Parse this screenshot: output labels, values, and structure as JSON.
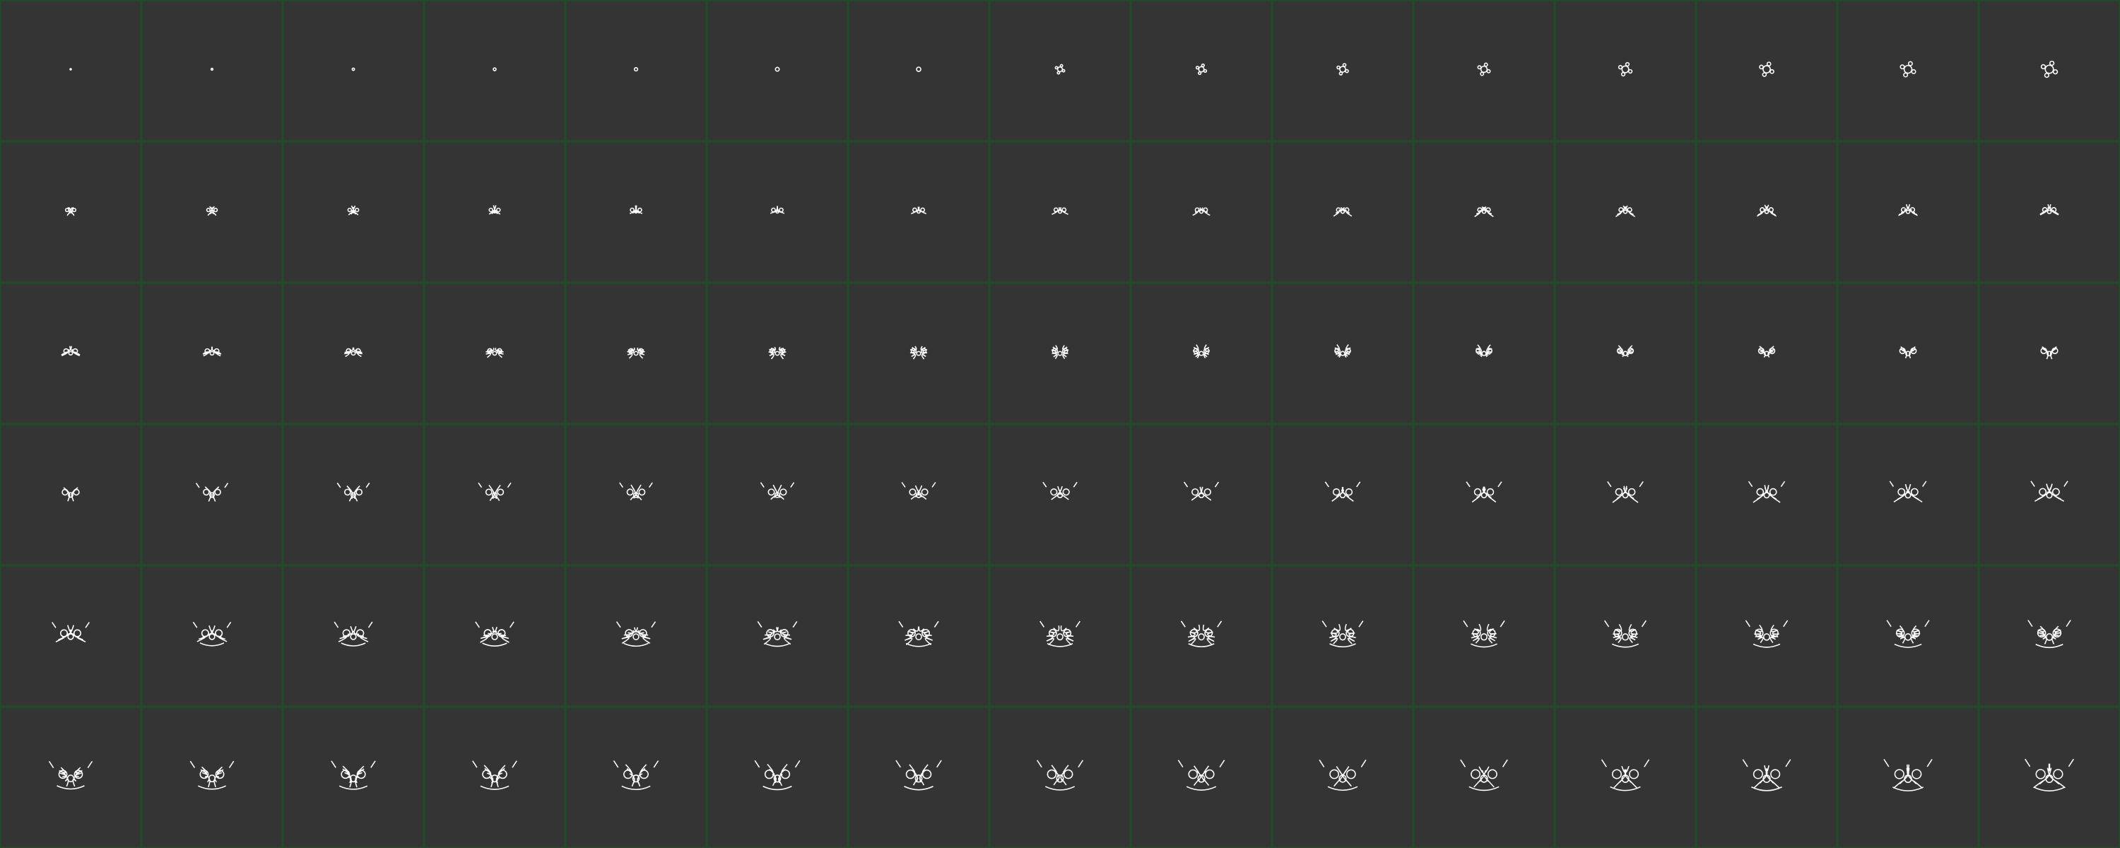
{
  "sprite_sheet": {
    "columns": 15,
    "rows": 6,
    "frame_count": 90,
    "background_color": "#343434",
    "gridline_color": "#25482a",
    "glyph_color": "#ffffff",
    "glyph_name": "symmetric-creature-glyph"
  }
}
